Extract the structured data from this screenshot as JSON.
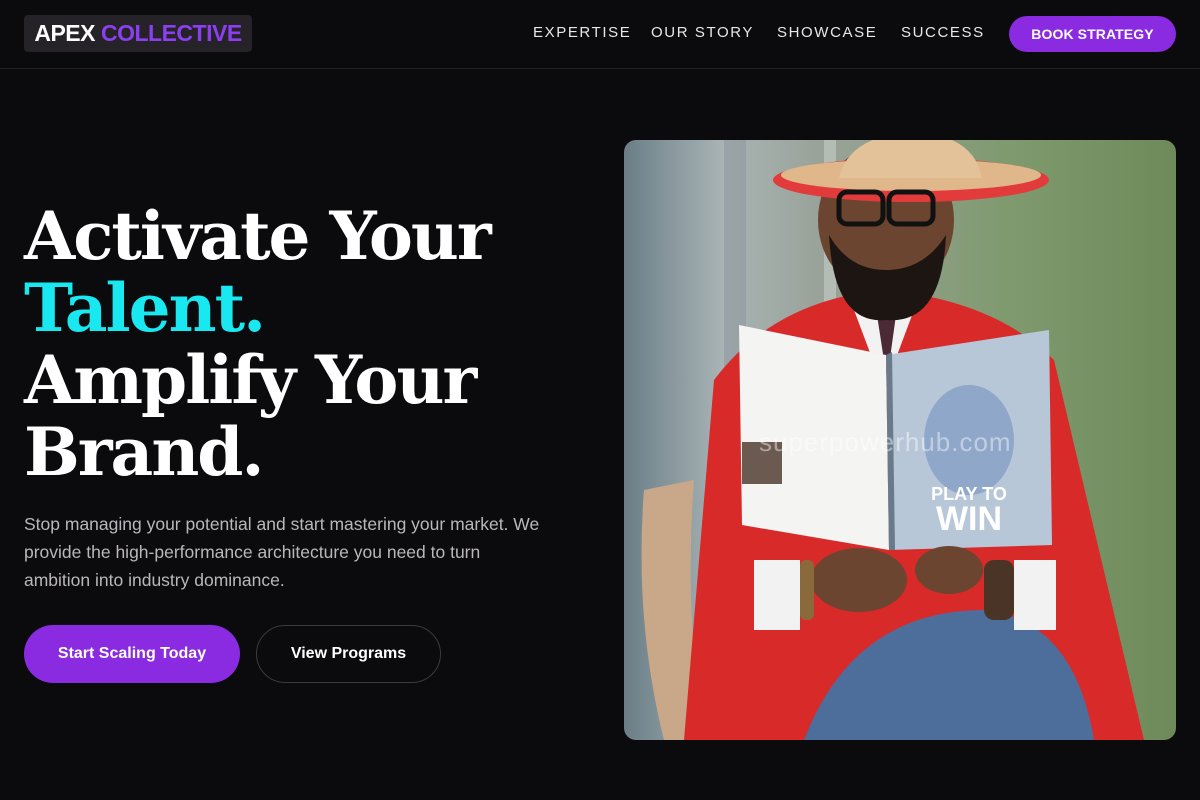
{
  "brand": {
    "name_part1": "APEX",
    "name_part2": "COLLECTIVE",
    "accent_color": "#8a2be2",
    "highlight_color": "#19e8f0"
  },
  "nav": {
    "items": [
      {
        "label": "EXPERTISE"
      },
      {
        "label": "OUR STORY"
      },
      {
        "label": "SHOWCASE"
      },
      {
        "label": "SUCCESS"
      }
    ],
    "cta_label": "BOOK STRATEGY"
  },
  "hero": {
    "headline_line1": "Activate Your",
    "headline_line2": "Talent.",
    "headline_line3": "Amplify Your",
    "headline_line4": "Brand.",
    "subtext": "Stop managing your potential and start mastering your market. We provide the high-performance architecture you need to turn ambition into industry dominance.",
    "primary_button": "Start Scaling Today",
    "secondary_button": "View Programs",
    "image": {
      "description_icon": "person-reading-book-photo",
      "watermark": "superpowerhub.com",
      "book_title_line1": "PLAY TO",
      "book_title_line2": "WIN"
    }
  }
}
